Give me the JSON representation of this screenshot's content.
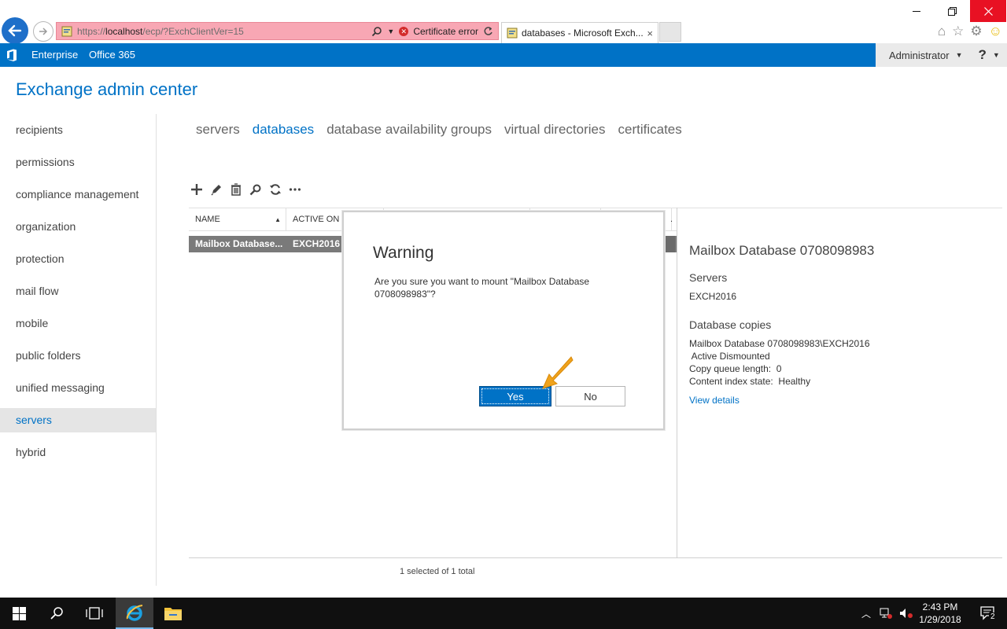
{
  "browser": {
    "url_prefix": "https://",
    "url_host": "localhost",
    "url_path": "/ecp/?ExchClientVer=15",
    "cert_error": "Certificate error",
    "tab_title": "databases - Microsoft Exch...",
    "tab_close": "×"
  },
  "suite_bar": {
    "enterprise": "Enterprise",
    "office365": "Office 365",
    "admin": "Administrator",
    "help": "?"
  },
  "app": {
    "title": "Exchange admin center"
  },
  "left_nav": {
    "items": [
      "recipients",
      "permissions",
      "compliance management",
      "organization",
      "protection",
      "mail flow",
      "mobile",
      "public folders",
      "unified messaging",
      "servers",
      "hybrid"
    ],
    "active": "servers"
  },
  "sub_nav": {
    "tabs": [
      "servers",
      "databases",
      "database availability groups",
      "virtual directories",
      "certificates"
    ],
    "active": "databases"
  },
  "grid": {
    "columns": [
      "NAME",
      "ACTIVE ON S",
      "",
      "",
      "",
      "."
    ],
    "row": {
      "name": "Mailbox Database...",
      "active_on": "EXCH2016"
    },
    "status": "1 selected of 1 total"
  },
  "details": {
    "title": "Mailbox Database 0708098983",
    "servers_label": "Servers",
    "servers_value": "EXCH2016",
    "copies_label": "Database copies",
    "copy_name": "Mailbox Database 0708098983\\EXCH2016",
    "copy_status": " Active Dismounted",
    "copy_queue": "Copy queue length:  0",
    "content_index": "Content index state:  Healthy",
    "view_details": "View details"
  },
  "dialog": {
    "title": "Warning",
    "message": "Are you sure you want to mount \"Mailbox Database 0708098983\"?",
    "yes": "Yes",
    "no": "No"
  },
  "taskbar": {
    "time": "2:43 PM",
    "date": "1/29/2018",
    "notifications": "2"
  },
  "colors": {
    "accent": "#0072c6",
    "address_error": "#f8a7b4",
    "selected_row": "#7a7a7a"
  }
}
